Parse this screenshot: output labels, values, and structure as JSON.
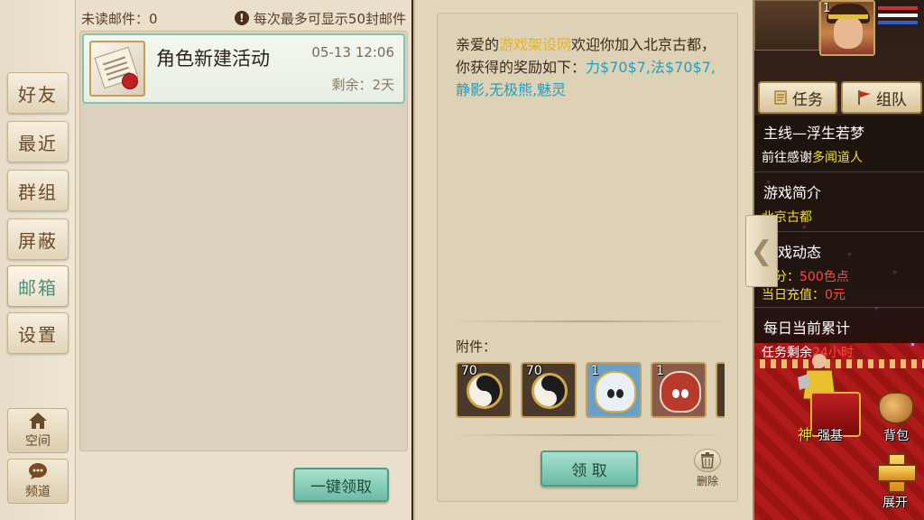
{
  "sidebar": {
    "tabs": [
      "好友",
      "最近",
      "群组",
      "屏蔽",
      "邮箱",
      "设置"
    ],
    "active_index": 4,
    "space_label": "空间",
    "channel_label": "频道"
  },
  "mail_list": {
    "unread_label": "未读邮件：0",
    "limit_notice": "每次最多可显示50封邮件",
    "items": [
      {
        "title": "角色新建活动",
        "date": "05-13 12:06",
        "remaining": "剩余：2天"
      }
    ],
    "claim_all_label": "一键领取"
  },
  "mail_detail": {
    "body_prefix": "亲爱的",
    "sender_name": "游戏架设网",
    "body_mid": "欢迎你加入北京古都，你获得的奖励如下：",
    "rewards": "力$70$7,法$70$7,静影,无极熊,魅灵",
    "attachments_label": "附件：",
    "attachments": [
      {
        "count": "70",
        "icon": "taiji-icon"
      },
      {
        "count": "70",
        "icon": "taiji-icon"
      },
      {
        "count": "1",
        "icon": "white-pet-icon"
      },
      {
        "count": "1",
        "icon": "red-beast-icon"
      }
    ],
    "claim_label": "领 取",
    "delete_label": "删除"
  },
  "hud": {
    "level": "1",
    "task_button": "任务",
    "team_button": "组队",
    "quests": [
      {
        "title": "主线—浮生若梦",
        "line_prefix": "前往感谢",
        "line_target": "多闻道人"
      },
      {
        "title": "游戏简介",
        "line_target": "北京古都"
      },
      {
        "title": "游戏动态",
        "line_prefix": "积分：",
        "line_target": "500色点",
        "line2_prefix": "当日充值：",
        "line2_value": "0元"
      },
      {
        "title": "每日当前累计",
        "line_prefix": "任务剩余",
        "line_target": "24小时"
      }
    ],
    "bag_label": "背包",
    "expand_label": "展开",
    "chest_label": "强基",
    "god_label": "神",
    "collapse_glyph": "❮"
  },
  "colors": {
    "accent_green": "#6cbba4",
    "highlight_yellow": "#e6b420",
    "highlight_cyan": "#1f9fc2",
    "quest_yellow": "#f4e024",
    "quest_red": "#ff4a3a",
    "hp_bar": "#d03030",
    "mp_bar": "#3060d0"
  }
}
